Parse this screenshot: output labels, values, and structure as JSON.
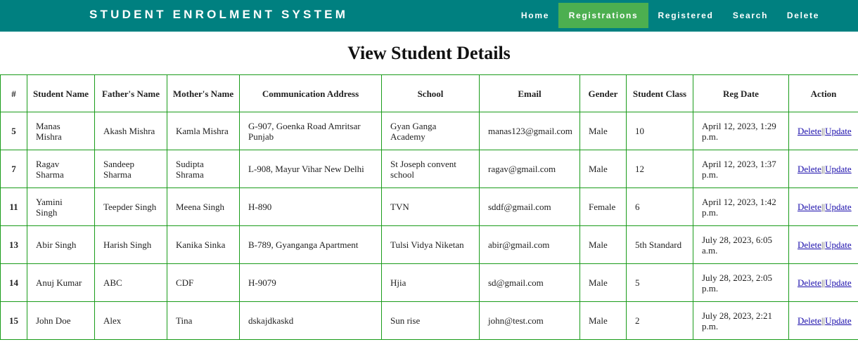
{
  "navbar": {
    "brand": "STUDENT ENROLMENT SYSTEM",
    "items": [
      {
        "label": "Home",
        "active": false
      },
      {
        "label": "Registrations",
        "active": true
      },
      {
        "label": "Registered",
        "active": false
      },
      {
        "label": "Search",
        "active": false
      },
      {
        "label": "Delete",
        "active": false
      }
    ]
  },
  "page": {
    "title": "View Student Details"
  },
  "table": {
    "headers": [
      "#",
      "Student Name",
      "Father's Name",
      "Mother's Name",
      "Communication Address",
      "School",
      "Email",
      "Gender",
      "Student Class",
      "Reg Date",
      "Action"
    ],
    "action_labels": {
      "delete": "Delete",
      "separator": "||",
      "update": "Update"
    },
    "rows": [
      {
        "id": "5",
        "student": "Manas Mishra",
        "father": "Akash Mishra",
        "mother": "Kamla Mishra",
        "address": "G-907, Goenka Road Amritsar Punjab",
        "school": "Gyan Ganga Academy",
        "email": "manas123@gmail.com",
        "gender": "Male",
        "class": "10",
        "reg_date": "April 12, 2023, 1:29 p.m."
      },
      {
        "id": "7",
        "student": "Ragav Sharma",
        "father": "Sandeep Sharma",
        "mother": "Sudipta Shrama",
        "address": "L-908, Mayur Vihar New Delhi",
        "school": "St Joseph convent school",
        "email": "ragav@gmail.com",
        "gender": "Male",
        "class": "12",
        "reg_date": "April 12, 2023, 1:37 p.m."
      },
      {
        "id": "11",
        "student": "Yamini Singh",
        "father": "Teepder Singh",
        "mother": "Meena Singh",
        "address": "H-890",
        "school": "TVN",
        "email": "sddf@gmail.com",
        "gender": "Female",
        "class": "6",
        "reg_date": "April 12, 2023, 1:42 p.m."
      },
      {
        "id": "13",
        "student": "Abir Singh",
        "father": "Harish Singh",
        "mother": "Kanika Sinka",
        "address": "B-789, Gyanganga Apartment",
        "school": "Tulsi Vidya Niketan",
        "email": "abir@gmail.com",
        "gender": "Male",
        "class": "5th Standard",
        "reg_date": "July 28, 2023, 6:05 a.m."
      },
      {
        "id": "14",
        "student": "Anuj Kumar",
        "father": "ABC",
        "mother": "CDF",
        "address": "H-9079",
        "school": "Hjia",
        "email": "sd@gmail.com",
        "gender": "Male",
        "class": "5",
        "reg_date": "July 28, 2023, 2:05 p.m."
      },
      {
        "id": "15",
        "student": "John Doe",
        "father": "Alex",
        "mother": "Tina",
        "address": "dskajdkaskd",
        "school": "Sun rise",
        "email": "john@test.com",
        "gender": "Male",
        "class": "2",
        "reg_date": "July 28, 2023, 2:21 p.m."
      }
    ]
  },
  "colors": {
    "navbar": "#008080",
    "active_nav": "#4caf50",
    "table_border": "#1a9c1a",
    "link": "#1a0dab"
  }
}
